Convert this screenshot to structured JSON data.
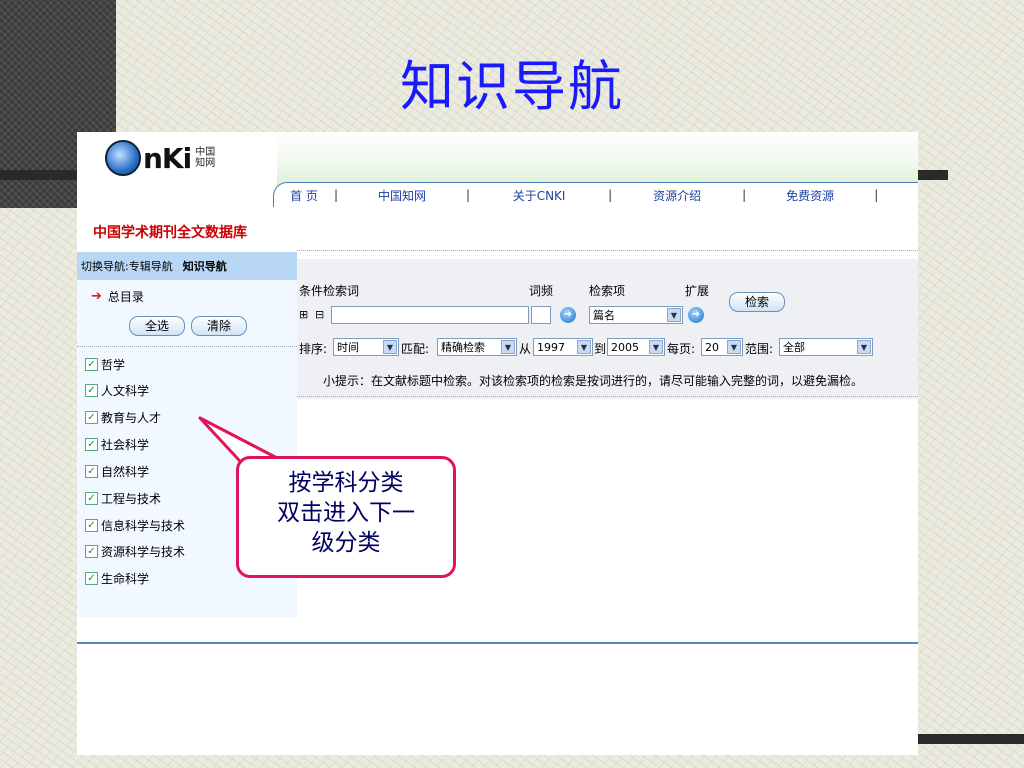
{
  "slide_title": "知识导航",
  "app": {
    "logo": {
      "text": "nKi",
      "sub_cn_top": "中国",
      "sub_cn_bottom": "知网"
    },
    "nav": [
      "首 页",
      "中国知网",
      "关于CNKI",
      "资源介绍",
      "免费资源"
    ],
    "db_title": "中国学术期刊全文数据库"
  },
  "sidebar": {
    "tab_prefix": "切换导航:专辑导航",
    "tab_active": "知识导航",
    "root_label": "总目录",
    "select_all": "全选",
    "clear": "清除",
    "categories": [
      "哲学",
      "人文科学",
      "教育与人才",
      "社会科学",
      "自然科学",
      "工程与技术",
      "信息科学与技术",
      "资源科学与技术",
      "生命科学"
    ]
  },
  "search": {
    "condition_label": "条件检索词",
    "freq_label": "词频",
    "field_label": "检索项",
    "expand_label": "扩展",
    "search_button": "检索",
    "plus": "⊞",
    "minus": "⊟",
    "field_value": "篇名",
    "sort_label": "排序:",
    "sort_value": "时间",
    "match_label": "匹配:",
    "match_value": "精确检索",
    "from_label": "从",
    "from_value": "1997",
    "to_label": "到",
    "to_value": "2005",
    "perpage_label": "每页:",
    "perpage_value": "20",
    "range_label": "范围:",
    "range_value": "全部",
    "tip": "小提示：在文献标题中检索。对该检索项的检索是按词进行的，请尽可能输入完整的词，以避免漏检。"
  },
  "callout": {
    "line1": "按学科分类",
    "line2": "双击进入下一",
    "line3": "级分类"
  }
}
